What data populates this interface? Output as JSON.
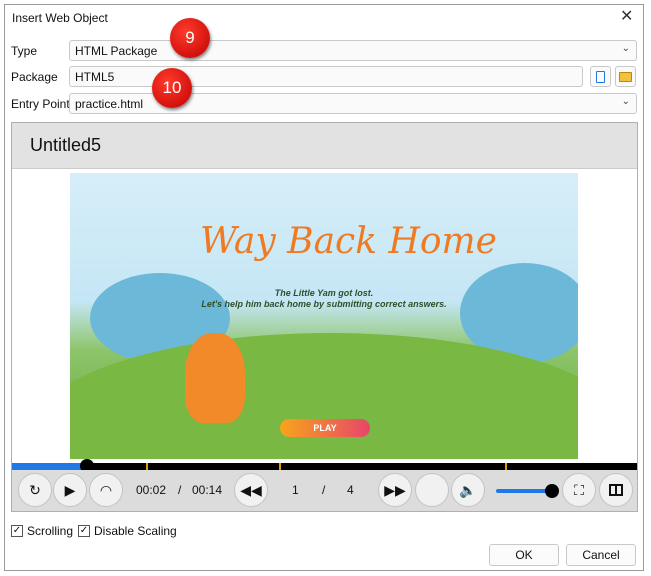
{
  "dialog": {
    "title": "Insert Web Object"
  },
  "form": {
    "type_label": "Type",
    "type_value": "HTML Package",
    "package_label": "Package",
    "package_value": "HTML5",
    "entry_label": "Entry Point",
    "entry_value": "practice.html"
  },
  "preview": {
    "title": "Untitled5",
    "game_title": "Way Back Home",
    "subtitle1": "The Little Yam got lost.",
    "subtitle2": "Let's help him back home by submitting correct answers.",
    "play_label": "PLAY"
  },
  "player": {
    "current_time": "00:02",
    "sep": "/",
    "total_time": "00:14",
    "page": "1",
    "page_sep": "/",
    "pages": "4",
    "progress": 0.12,
    "volume": 1.0
  },
  "options": {
    "scrolling": "Scrolling",
    "disable_scaling": "Disable Scaling"
  },
  "buttons": {
    "ok": "OK",
    "cancel": "Cancel"
  },
  "annotations": {
    "a9": "9",
    "a10": "10"
  },
  "colors": {
    "accent": "#1e78e6",
    "badge": "#d40000"
  }
}
